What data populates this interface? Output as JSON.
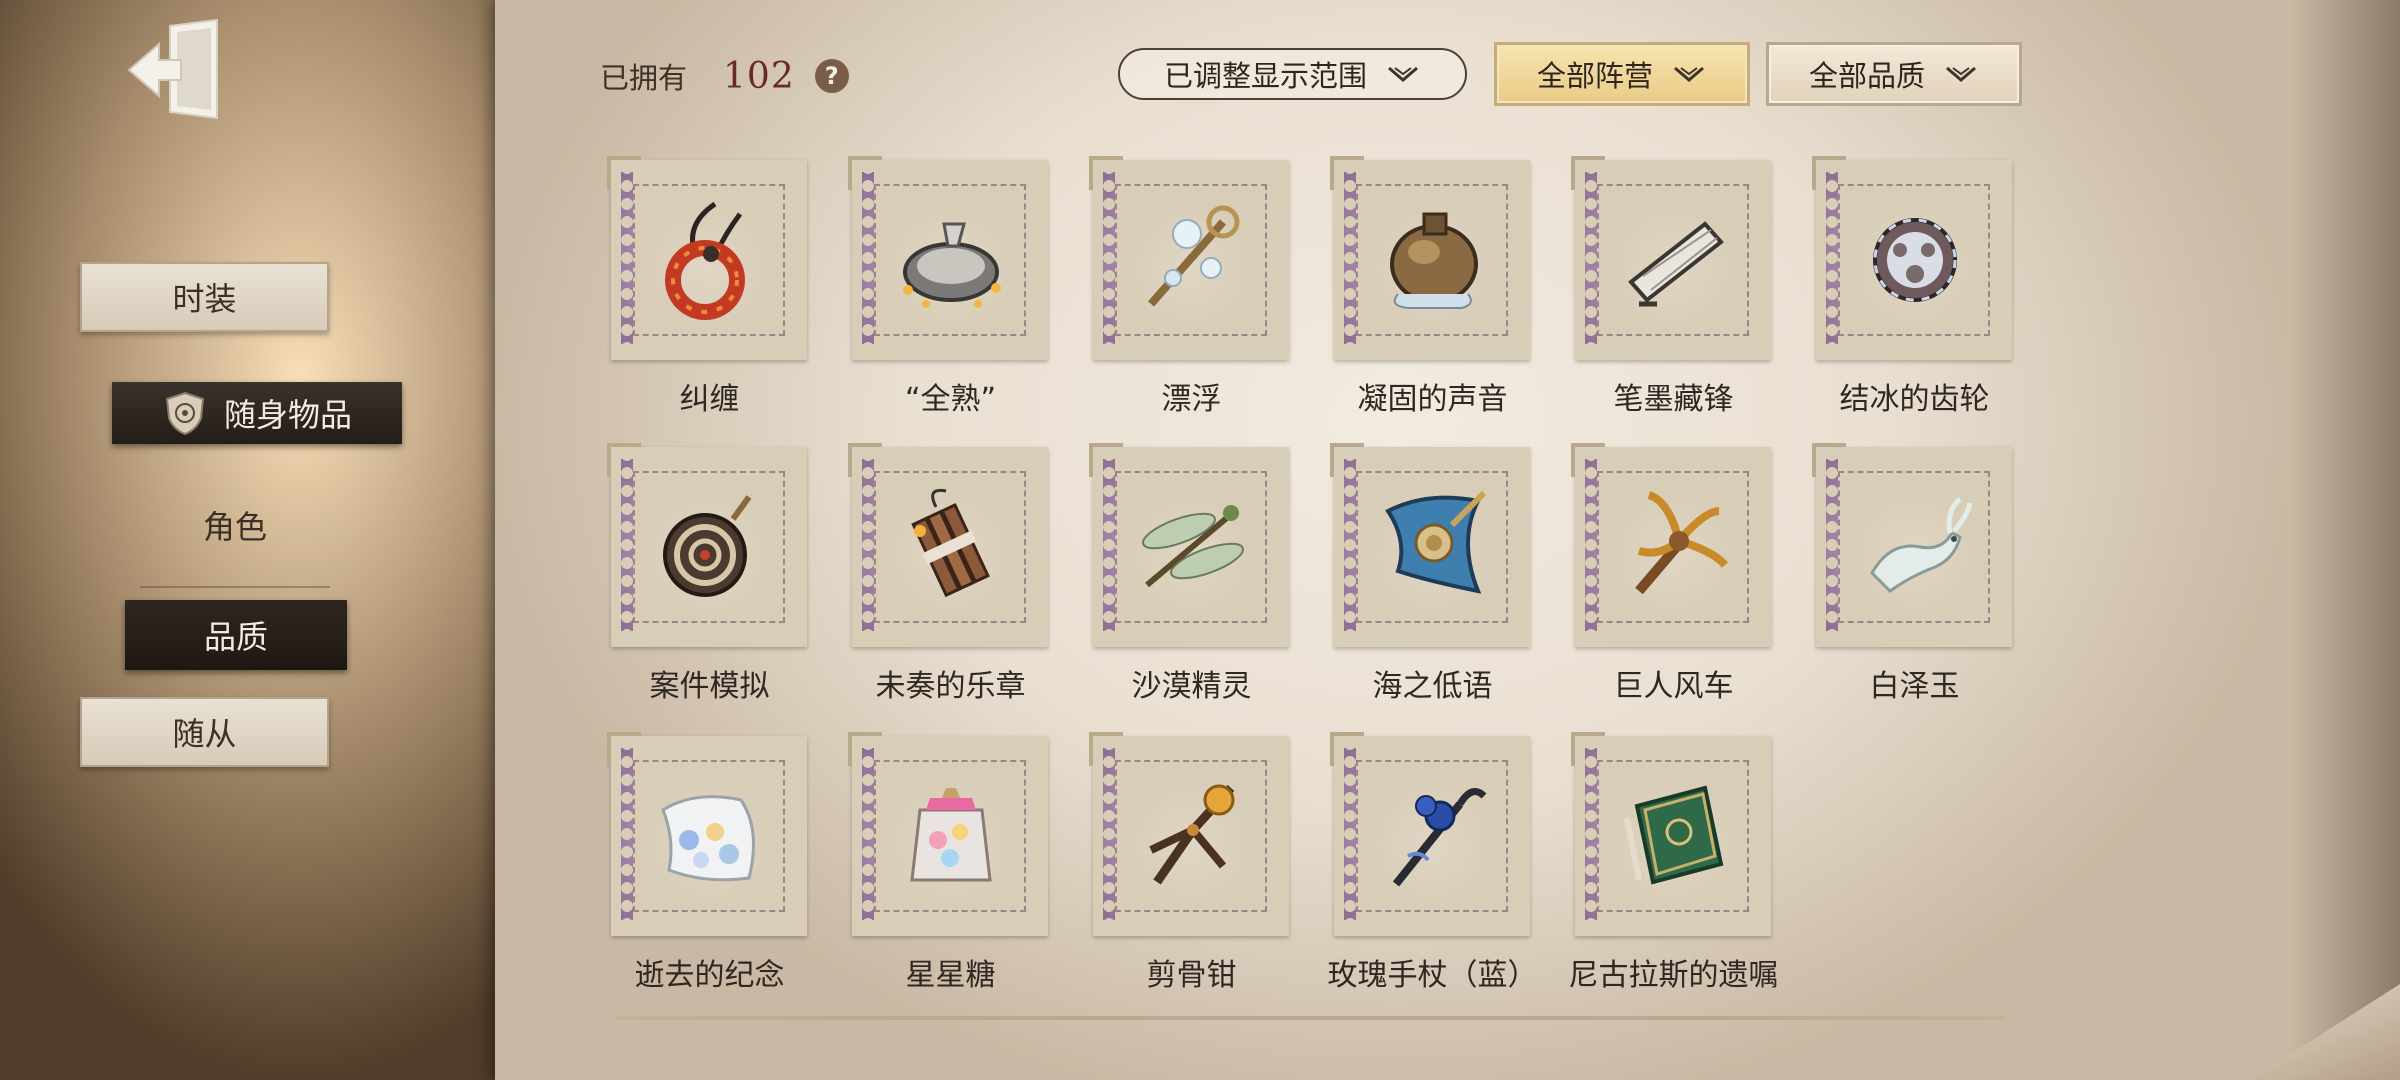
{
  "nav": {
    "fashion": "时装",
    "accessories": "随身物品",
    "character": "角色",
    "quality": "品质",
    "follower": "随从"
  },
  "header": {
    "owned_label": "已拥有",
    "owned_count": "102",
    "help": "?"
  },
  "filters": {
    "range": "已调整显示范围",
    "faction": "全部阵营",
    "quality": "全部品质"
  },
  "items": [
    {
      "name": "纠缠",
      "icon": "red-ring-pendant"
    },
    {
      "name": "“全熟”",
      "icon": "frying-pan"
    },
    {
      "name": "漂浮",
      "icon": "bubble-wand"
    },
    {
      "name": "凝固的声音",
      "icon": "bronze-vase"
    },
    {
      "name": "笔墨藏锋",
      "icon": "scroll-brush"
    },
    {
      "name": "结冰的齿轮",
      "icon": "frozen-gear"
    },
    {
      "name": "案件模拟",
      "icon": "spinning-top"
    },
    {
      "name": "未奏的乐章",
      "icon": "dynamite-bundle"
    },
    {
      "name": "沙漠精灵",
      "icon": "dragonfly"
    },
    {
      "name": "海之低语",
      "icon": "sea-shell-blade"
    },
    {
      "name": "巨人风车",
      "icon": "antler-windmill"
    },
    {
      "name": "白泽玉",
      "icon": "jade-deer"
    },
    {
      "name": "逝去的纪念",
      "icon": "flower-box"
    },
    {
      "name": "星星糖",
      "icon": "candy-jar"
    },
    {
      "name": "剪骨钳",
      "icon": "bone-pliers"
    },
    {
      "name": "玫瑰手杖（蓝）",
      "icon": "blue-rose-cane"
    },
    {
      "name": "尼古拉斯的遗嘱",
      "icon": "green-book"
    }
  ]
}
